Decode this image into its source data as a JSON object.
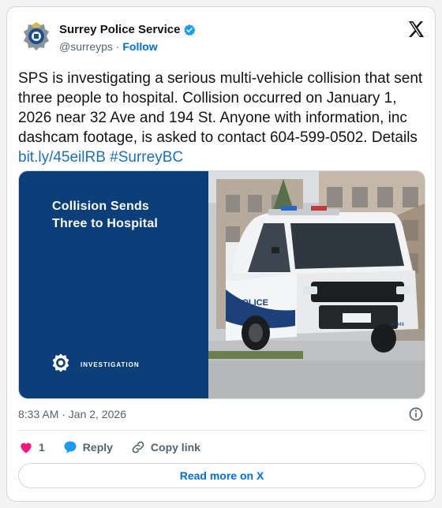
{
  "tweet": {
    "display_name": "Surrey Police Service",
    "handle": "@surreyps",
    "separator": " · ",
    "follow_label": "Follow",
    "text_main": "SPS is investigating a serious multi-vehicle collision that sent three people to hospital. Collision occurred on January 1, 2026 near 32 Ave and 194 St. Anyone with information, inc dashcam footage, is asked to contact 604-599-0502. Details ",
    "link_text": "bit.ly/45eilRB",
    "hashtag": "#SurreyBC",
    "timestamp": "8:33 AM · Jan 2, 2026",
    "likes_count": "1",
    "reply_label": "Reply",
    "copy_link_label": "Copy link",
    "read_more_label": "Read more on X"
  },
  "media": {
    "title_line1": "Collision Sends",
    "title_line2": "Three to Hospital",
    "tag": "INVESTIGATION",
    "car_door_text": "POLICE",
    "car_unit": "SP946"
  },
  "colors": {
    "panel_blue": "#0c3f79",
    "link_blue": "#1d6fb8",
    "verified_blue": "#1d9bf0",
    "heart_pink": "#f91880"
  },
  "icons": [
    "police-badge-icon",
    "verified-icon",
    "x-logo-icon",
    "info-icon",
    "heart-icon",
    "reply-bubble-icon",
    "link-icon"
  ]
}
